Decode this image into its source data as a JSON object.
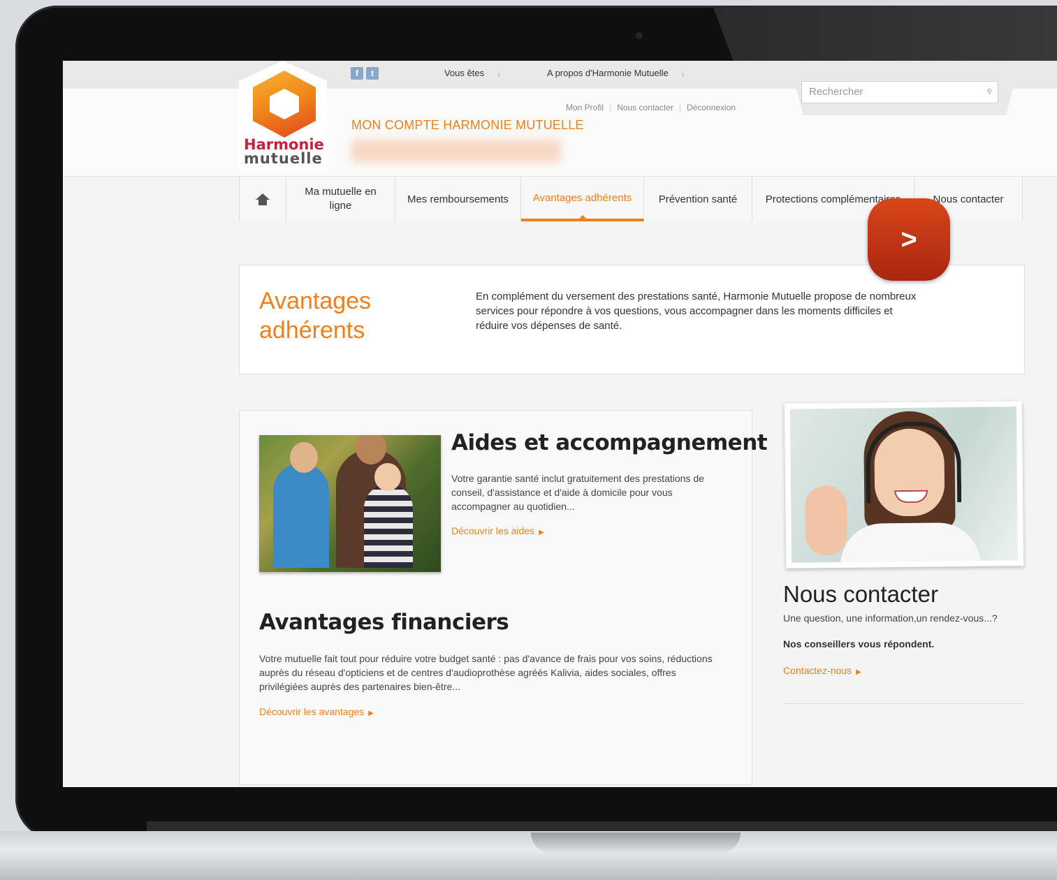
{
  "social": {
    "facebook": "f",
    "twitter": "t"
  },
  "topnav": {
    "vous_etes": "Vous êtes",
    "a_propos": "A propos d'Harmonie Mutuelle",
    "arrow": "↓"
  },
  "search": {
    "placeholder": "Rechercher",
    "icon": "search-icon"
  },
  "account_links": {
    "profil": "Mon Profil",
    "contacter": "Nous contacter",
    "deconnexion": "Déconnexion"
  },
  "account_title": "MON COMPTE HARMONIE MUTUELLE",
  "logo": {
    "line1": "Harmonie",
    "line2": "mutuelle"
  },
  "mainnav": {
    "items": [
      {
        "label": "Ma mutuelle en ligne"
      },
      {
        "label": "Mes remboursements"
      },
      {
        "label": "Avantages adhérents"
      },
      {
        "label": "Prévention santé"
      },
      {
        "label": "Protections complémentaires"
      },
      {
        "label": "Nous contacter"
      }
    ],
    "active": "Avantages adhérents"
  },
  "intro": {
    "title": "Avantages adhérents",
    "text": "En complément du versement des prestations santé, Harmonie Mutuelle propose de nombreux services pour répondre à vos questions, vous accompagner dans les moments difficiles et réduire vos dépenses de santé."
  },
  "play_button": ">",
  "section1": {
    "title": "Aides et accompagnement",
    "text": "Votre garantie santé inclut gratuitement des prestations de conseil, d'assistance et d'aide à domicile pour vous accompagner au quotidien...",
    "link": "Découvrir les aides"
  },
  "section2": {
    "title": "Avantages financiers",
    "text": "Votre mutuelle fait tout pour réduire votre budget santé : pas d'avance de frais pour vos soins, réductions auprès du réseau d'opticiens et de centres d'audioprothèse agréés Kalivia, aides sociales, offres privilégiées auprès des partenaires bien-être...",
    "link": "Découvrir les avantages"
  },
  "contact": {
    "title": "Nous contacter",
    "text": "Une question, une information,un rendez-vous...?",
    "strong": "Nos conseillers vous répondent.",
    "link": "Contactez-nous"
  },
  "colors": {
    "accent": "#f07f1b",
    "play": "#c0361a",
    "brand_red": "#c8203f"
  }
}
